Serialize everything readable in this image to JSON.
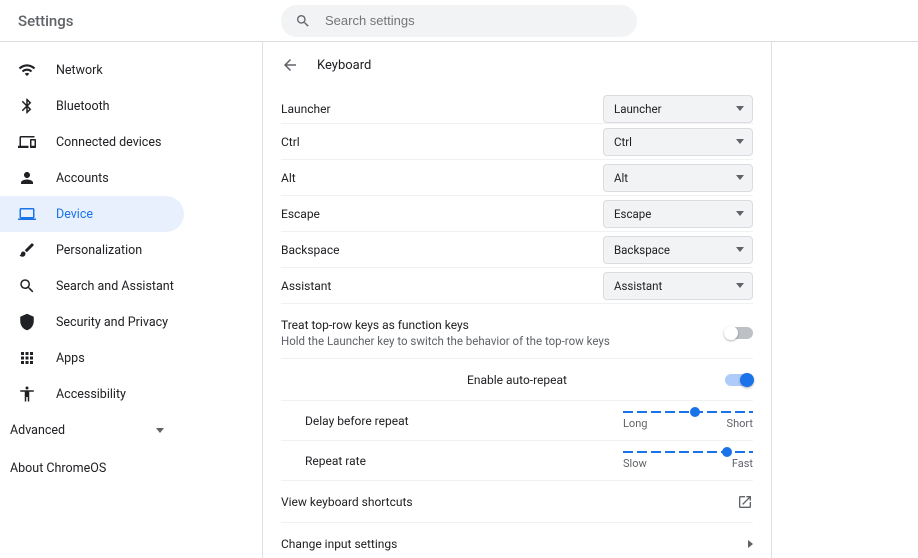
{
  "header": {
    "title": "Settings",
    "search_placeholder": "Search settings"
  },
  "sidebar": {
    "items": [
      {
        "icon": "wifi",
        "label": "Network"
      },
      {
        "icon": "bluetooth",
        "label": "Bluetooth"
      },
      {
        "icon": "devices",
        "label": "Connected devices"
      },
      {
        "icon": "person",
        "label": "Accounts"
      },
      {
        "icon": "laptop",
        "label": "Device"
      },
      {
        "icon": "brush",
        "label": "Personalization"
      },
      {
        "icon": "search",
        "label": "Search and Assistant"
      },
      {
        "icon": "shield",
        "label": "Security and Privacy"
      },
      {
        "icon": "apps",
        "label": "Apps"
      },
      {
        "icon": "accessibility",
        "label": "Accessibility"
      }
    ],
    "advanced": "Advanced",
    "about": "About ChromeOS"
  },
  "page": {
    "title": "Keyboard",
    "key_rows": [
      {
        "label": "Launcher",
        "value": "Launcher"
      },
      {
        "label": "Ctrl",
        "value": "Ctrl"
      },
      {
        "label": "Alt",
        "value": "Alt"
      },
      {
        "label": "Escape",
        "value": "Escape"
      },
      {
        "label": "Backspace",
        "value": "Backspace"
      },
      {
        "label": "Assistant",
        "value": "Assistant"
      }
    ],
    "toprow": {
      "label": "Treat top-row keys as function keys",
      "sub": "Hold the Launcher key to switch the behavior of the top-row keys",
      "on": false
    },
    "autorepeat": {
      "label": "Enable auto-repeat",
      "on": true,
      "delay": {
        "label": "Delay before repeat",
        "lo": "Long",
        "hi": "Short",
        "pos": 55
      },
      "rate": {
        "label": "Repeat rate",
        "lo": "Slow",
        "hi": "Fast",
        "pos": 80
      }
    },
    "links": {
      "shortcuts": "View keyboard shortcuts",
      "input": "Change input settings"
    }
  }
}
